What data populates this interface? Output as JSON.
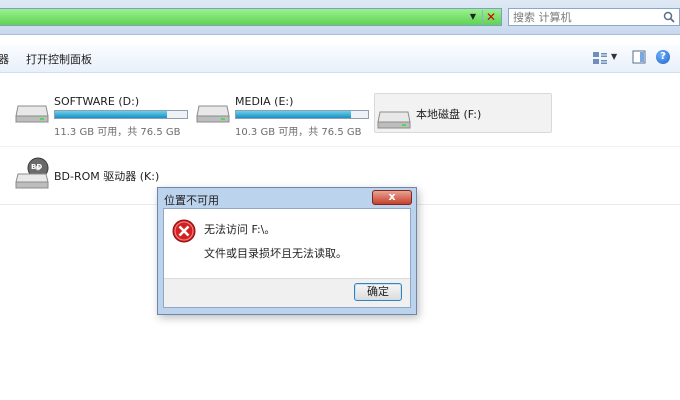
{
  "search": {
    "placeholder": "搜索 计算机"
  },
  "toolbar": {
    "cut_item": "器",
    "control_panel": "打开控制面板"
  },
  "drives": [
    {
      "name": "SOFTWARE (D:)",
      "size_text": "11.3 GB 可用，共 76.5 GB",
      "used_fraction": 0.85
    },
    {
      "name": "MEDIA (E:)",
      "size_text": "10.3 GB 可用，共 76.5 GB",
      "used_fraction": 0.87
    },
    {
      "name": "本地磁盘 (F:)"
    },
    {
      "name": "BD-ROM 驱动器 (K:)",
      "icon_label": "BD"
    }
  ],
  "dialog": {
    "title": "位置不可用",
    "close_label": "x",
    "message_line1": "无法访问 F:\\。",
    "message_line2": "文件或目录损坏且无法读取。",
    "ok_label": "确定"
  },
  "colors": {
    "address_bar": "#5fd352",
    "progress_fill": "#1a8fc2",
    "dialog_frame": "#bcd3ee",
    "close_button": "#c5402b",
    "error_icon": "#d32020"
  }
}
